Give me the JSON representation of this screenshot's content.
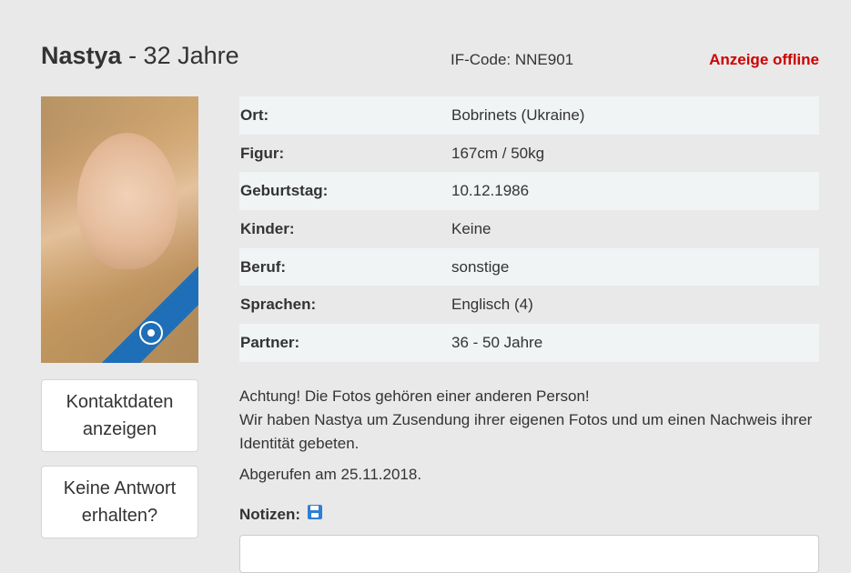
{
  "profile": {
    "name": "Nastya",
    "age_text": " - 32 Jahre",
    "if_code": "IF-Code: NNE901",
    "status": "Anzeige offline"
  },
  "photo": {
    "badge_icon": "eye-icon",
    "badge_color": "#1f6fb8"
  },
  "buttons": {
    "contact": "Kontaktdaten\nanzeigen",
    "no_reply": "Keine Antwort\nerhalten?"
  },
  "details": [
    {
      "label": "Ort:",
      "value": "Bobrinets (Ukraine)"
    },
    {
      "label": "Figur:",
      "value": "167cm / 50kg"
    },
    {
      "label": "Geburtstag:",
      "value": "10.12.1986"
    },
    {
      "label": "Kinder:",
      "value": "Keine"
    },
    {
      "label": "Beruf:",
      "value": "sonstige"
    },
    {
      "label": "Sprachen:",
      "value": "Englisch (4)"
    },
    {
      "label": "Partner:",
      "value": "36 - 50 Jahre"
    }
  ],
  "notice": {
    "line1": "Achtung! Die Fotos gehören einer anderen Person!",
    "line2": "Wir haben Nastya um Zusendung ihrer eigenen Fotos und um einen Nachweis ihrer Identität gebeten."
  },
  "retrieved": "Abgerufen am 25.11.2018.",
  "notes": {
    "label": "Notizen:",
    "save_icon": "save-icon",
    "value": ""
  },
  "colors": {
    "status_red": "#cc0000",
    "accent_blue": "#2d7fd3"
  }
}
